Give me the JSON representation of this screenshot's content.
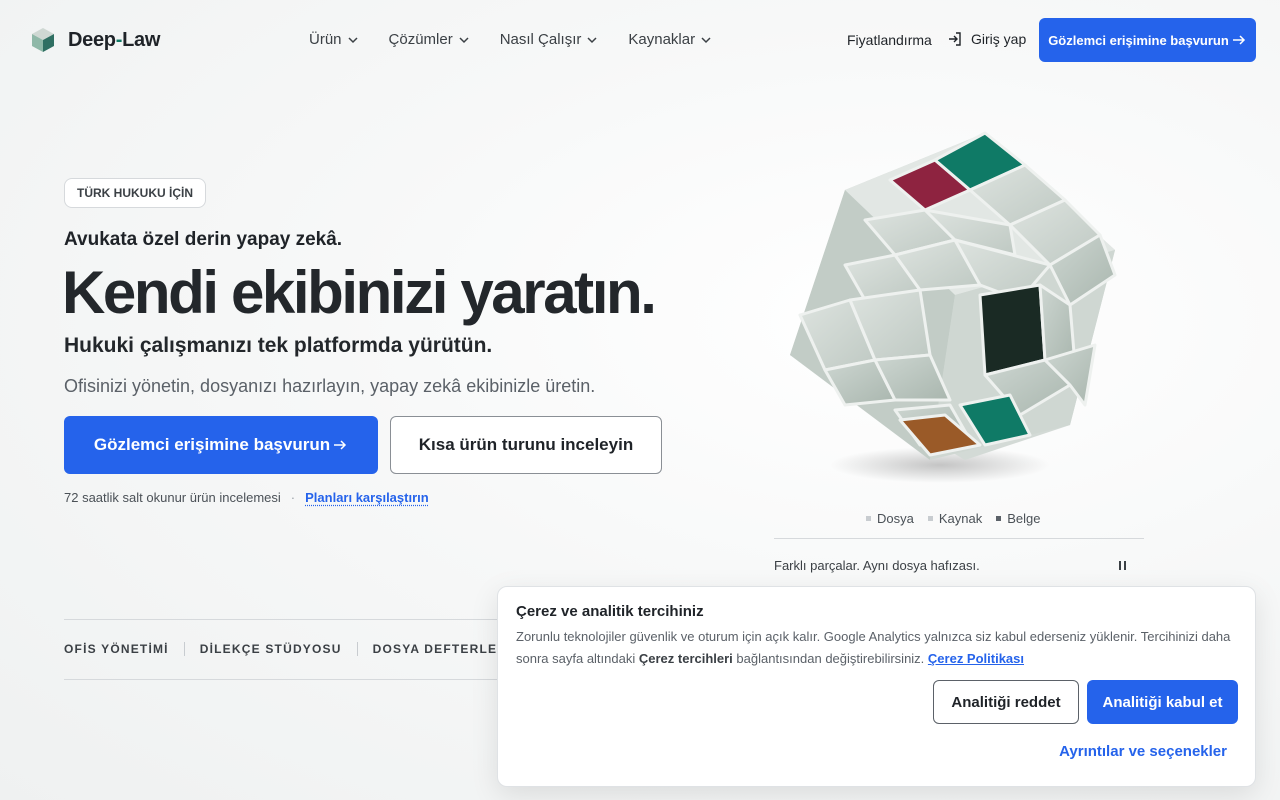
{
  "header": {
    "logo_prefix": "Deep",
    "logo_hyphen": "-",
    "logo_suffix": "Law",
    "nav": [
      {
        "label": "Ürün"
      },
      {
        "label": "Çözümler"
      },
      {
        "label": "Nasıl Çalışır"
      },
      {
        "label": "Kaynaklar"
      }
    ],
    "pricing": "Fiyatlandırma",
    "login": "Giriş yap",
    "cta": "Gözlemci erişimine başvurun"
  },
  "hero": {
    "badge": "TÜRK HUKUKU İÇİN",
    "eyebrow": "Avukata özel derin yapay zekâ.",
    "headline": "Kendi ekibinizi yaratın.",
    "sub1": "Hukuki çalışmanızı tek platformda yürütün.",
    "sub2": "Ofisinizi yönetin, dosyanızı hazırlayın, yapay zekâ ekibinizle üretin.",
    "cta_primary": "Gözlemci erişimine başvurun",
    "cta_secondary": "Kısa ürün turunu inceleyin",
    "note": "72 saatlik salt okunur ürün incelemesi",
    "note_sep": "·",
    "note_link": "Planları karşılaştırın"
  },
  "visual": {
    "legend": [
      {
        "label": "Dosya"
      },
      {
        "label": "Kaynak"
      },
      {
        "label": "Belge"
      }
    ],
    "caption": "Farklı parçalar. Aynı dosya hafızası."
  },
  "tabs": [
    "OFİS YÖNETİMİ",
    "DİLEKÇE STÜDYOSU",
    "DOSYA DEFTERLERİ"
  ],
  "cookie": {
    "title": "Çerez ve analitik tercihiniz",
    "body_1": "Zorunlu teknolojiler güvenlik ve oturum için açık kalır. Google Analytics yalnızca siz kabul ederseniz yüklenir. Tercihinizi daha sonra sayfa altındaki ",
    "body_bold": "Çerez tercihleri",
    "body_2": " bağlantısından değiştirebilirsiniz. ",
    "policy_link": "Çerez Politikası",
    "reject": "Analitiği reddet",
    "accept": "Analitiği kabul et",
    "details": "Ayrıntılar ve seçenekler"
  },
  "colors": {
    "primary": "#2563eb",
    "teal": "#0f7a66",
    "crimson": "#8e2340",
    "brown": "#9a5a28",
    "cube_grey": "#c9d2cd"
  },
  "icons": {
    "logo": "logo-cube-icon",
    "chevron": "chevron-down-icon",
    "login": "login-icon",
    "arrow": "arrow-right-icon",
    "pause": "pause-icon"
  }
}
